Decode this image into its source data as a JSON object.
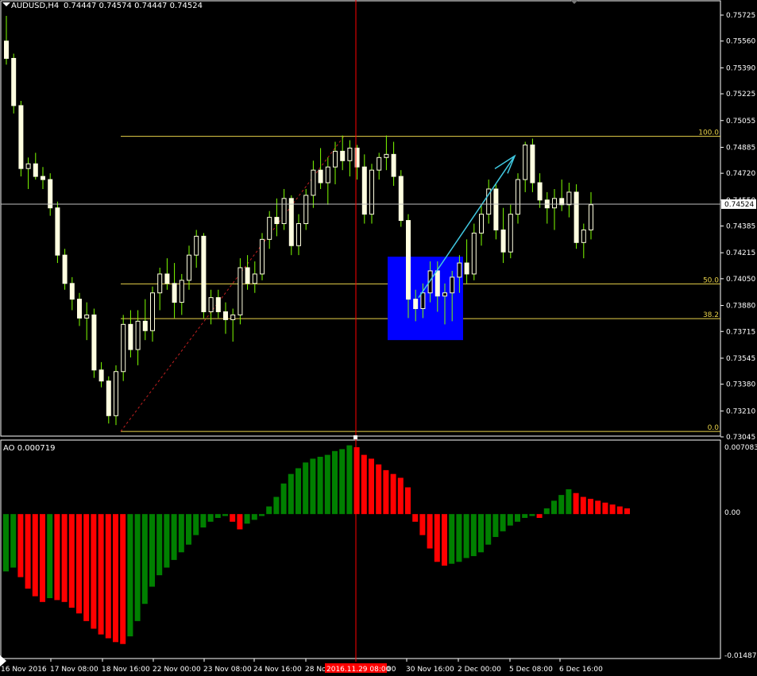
{
  "header": {
    "symbol": "AUDUSD,H4",
    "ohlc": "0.74447 0.74574 0.74447 0.74524"
  },
  "indicator": {
    "title": "AO 0.000719",
    "ticks": [
      "0.007083",
      "0.00",
      "-0.014871"
    ]
  },
  "price_axis": {
    "ticks": [
      "0.75725",
      "0.75560",
      "0.75390",
      "0.75225",
      "0.75055",
      "0.74885",
      "0.74720",
      "0.74550",
      "0.74385",
      "0.74215",
      "0.74050",
      "0.73880",
      "0.73715",
      "0.73545",
      "0.73380",
      "0.73210",
      "0.73045"
    ],
    "current": "0.74524"
  },
  "time_axis": {
    "labels": [
      "16 Nov 2016",
      "17 Nov 08:00",
      "18 Nov 16:00",
      "22 Nov 00:00",
      "23 Nov 08:00",
      "24 Nov 16:00",
      "28 No",
      "30 Nov 16:00",
      "2 Dec 00:00",
      "5 Dec 08:00",
      "6 Dec 16:00"
    ],
    "cursor_label": "2016.11.29 08:00",
    "cursor_suffix": "00"
  },
  "fibonacci": {
    "levels": [
      "100.0",
      "50.0",
      "38.2",
      "0.0"
    ]
  },
  "colors": {
    "bull": "#ffffe0",
    "wick": "#7fff00",
    "ao_up": "#008000",
    "ao_down": "#ff0000",
    "fib": "#e8d24a",
    "cursor": "#ff0000",
    "box": "#0000ff",
    "arrow": "#40c8e0"
  },
  "chart_data": [
    {
      "type": "candlestick",
      "title": "AUDUSD,H4",
      "ylim": [
        0.7302,
        0.7583
      ],
      "candles": [
        [
          0.7556,
          0.7572,
          0.7541,
          0.7545
        ],
        [
          0.7545,
          0.7548,
          0.751,
          0.7515
        ],
        [
          0.7515,
          0.7518,
          0.747,
          0.7475
        ],
        [
          0.7475,
          0.7482,
          0.7462,
          0.7478
        ],
        [
          0.7478,
          0.7485,
          0.7468,
          0.747
        ],
        [
          0.747,
          0.7476,
          0.7462,
          0.7468
        ],
        [
          0.7468,
          0.7472,
          0.7445,
          0.745
        ],
        [
          0.745,
          0.7454,
          0.7415,
          0.742
        ],
        [
          0.742,
          0.7424,
          0.7398,
          0.7402
        ],
        [
          0.7402,
          0.7406,
          0.7385,
          0.7392
        ],
        [
          0.7392,
          0.7396,
          0.7375,
          0.738
        ],
        [
          0.738,
          0.739,
          0.7366,
          0.7382
        ],
        [
          0.7382,
          0.7386,
          0.7342,
          0.7347
        ],
        [
          0.7347,
          0.7352,
          0.7336,
          0.734
        ],
        [
          0.734,
          0.7343,
          0.7313,
          0.7318
        ],
        [
          0.7318,
          0.735,
          0.7312,
          0.7346
        ],
        [
          0.7346,
          0.7382,
          0.734,
          0.7376
        ],
        [
          0.7376,
          0.7385,
          0.7355,
          0.736
        ],
        [
          0.736,
          0.7385,
          0.735,
          0.7378
        ],
        [
          0.7378,
          0.7392,
          0.7366,
          0.7372
        ],
        [
          0.7372,
          0.74,
          0.7365,
          0.7396
        ],
        [
          0.7396,
          0.7412,
          0.7385,
          0.7408
        ],
        [
          0.7408,
          0.7418,
          0.7398,
          0.7402
        ],
        [
          0.7402,
          0.7415,
          0.738,
          0.739
        ],
        [
          0.739,
          0.7408,
          0.7382,
          0.7404
        ],
        [
          0.7404,
          0.7426,
          0.7398,
          0.742
        ],
        [
          0.742,
          0.7436,
          0.7412,
          0.7432
        ],
        [
          0.7432,
          0.7434,
          0.738,
          0.7384
        ],
        [
          0.7384,
          0.7398,
          0.7376,
          0.7393
        ],
        [
          0.7393,
          0.7398,
          0.738,
          0.7384
        ],
        [
          0.7384,
          0.739,
          0.737,
          0.7379
        ],
        [
          0.7379,
          0.7386,
          0.7365,
          0.7382
        ],
        [
          0.7382,
          0.7418,
          0.7376,
          0.7412
        ],
        [
          0.7412,
          0.742,
          0.7398,
          0.7402
        ],
        [
          0.7402,
          0.7416,
          0.7396,
          0.7408
        ],
        [
          0.7408,
          0.7434,
          0.7404,
          0.743
        ],
        [
          0.743,
          0.7448,
          0.7424,
          0.7444
        ],
        [
          0.7444,
          0.7456,
          0.7432,
          0.744
        ],
        [
          0.744,
          0.7462,
          0.7436,
          0.7456
        ],
        [
          0.7456,
          0.7458,
          0.742,
          0.7426
        ],
        [
          0.7426,
          0.7446,
          0.742,
          0.744
        ],
        [
          0.744,
          0.7462,
          0.7436,
          0.7458
        ],
        [
          0.7458,
          0.748,
          0.745,
          0.7474
        ],
        [
          0.7474,
          0.7488,
          0.7462,
          0.7466
        ],
        [
          0.7466,
          0.7482,
          0.7452,
          0.7476
        ],
        [
          0.7476,
          0.7492,
          0.7465,
          0.7486
        ],
        [
          0.7486,
          0.7496,
          0.7474,
          0.748
        ],
        [
          0.748,
          0.7493,
          0.747,
          0.7488
        ],
        [
          0.7488,
          0.749,
          0.7468,
          0.7476
        ],
        [
          0.7476,
          0.7484,
          0.744,
          0.7446
        ],
        [
          0.7446,
          0.7478,
          0.744,
          0.7474
        ],
        [
          0.7474,
          0.7485,
          0.7468,
          0.7482
        ],
        [
          0.7482,
          0.7496,
          0.7474,
          0.7484
        ],
        [
          0.7484,
          0.7492,
          0.7464,
          0.747
        ],
        [
          0.747,
          0.7474,
          0.7438,
          0.7442
        ],
        [
          0.7442,
          0.7446,
          0.738,
          0.7392
        ],
        [
          0.7392,
          0.7398,
          0.7378,
          0.7386
        ],
        [
          0.7386,
          0.7402,
          0.738,
          0.7396
        ],
        [
          0.7396,
          0.7416,
          0.739,
          0.741
        ],
        [
          0.741,
          0.7416,
          0.7384,
          0.7394
        ],
        [
          0.7394,
          0.7402,
          0.7376,
          0.7396
        ],
        [
          0.7396,
          0.741,
          0.7378,
          0.7406
        ],
        [
          0.7406,
          0.742,
          0.7396,
          0.7415
        ],
        [
          0.7415,
          0.743,
          0.7402,
          0.7408
        ],
        [
          0.7408,
          0.744,
          0.7404,
          0.7434
        ],
        [
          0.7434,
          0.7452,
          0.7426,
          0.7446
        ],
        [
          0.7446,
          0.7468,
          0.744,
          0.7462
        ],
        [
          0.7462,
          0.7465,
          0.743,
          0.7436
        ],
        [
          0.7436,
          0.745,
          0.7415,
          0.7422
        ],
        [
          0.7422,
          0.7452,
          0.7418,
          0.7446
        ],
        [
          0.7446,
          0.7472,
          0.744,
          0.7468
        ],
        [
          0.7468,
          0.7492,
          0.746,
          0.749
        ],
        [
          0.749,
          0.7494,
          0.746,
          0.7466
        ],
        [
          0.7466,
          0.7472,
          0.745,
          0.7455
        ],
        [
          0.7455,
          0.746,
          0.744,
          0.745
        ],
        [
          0.745,
          0.7462,
          0.7436,
          0.7456
        ],
        [
          0.7456,
          0.7468,
          0.7448,
          0.7452
        ],
        [
          0.7452,
          0.7466,
          0.7444,
          0.746
        ],
        [
          0.746,
          0.7465,
          0.7424,
          0.7428
        ],
        [
          0.7428,
          0.744,
          0.7418,
          0.7436
        ],
        [
          0.7436,
          0.746,
          0.743,
          0.7452
        ]
      ]
    },
    {
      "type": "bar",
      "title": "AO 0.000719",
      "ylim": [
        -0.014871,
        0.007083
      ],
      "values": [
        -0.006,
        -0.0056,
        -0.0066,
        -0.0078,
        -0.0086,
        -0.0092,
        -0.0088,
        -0.009,
        -0.0092,
        -0.0098,
        -0.0104,
        -0.0112,
        -0.012,
        -0.0126,
        -0.013,
        -0.0134,
        -0.0136,
        -0.0128,
        -0.0112,
        -0.0094,
        -0.0076,
        -0.0064,
        -0.0056,
        -0.0048,
        -0.004,
        -0.0032,
        -0.0022,
        -0.0014,
        -0.0008,
        -0.0004,
        -0.0002,
        -0.0008,
        -0.0016,
        -0.001,
        -0.0006,
        -0.0002,
        0.0008,
        0.0018,
        0.0032,
        0.0042,
        0.0048,
        0.0054,
        0.0058,
        0.006,
        0.0062,
        0.0066,
        0.0068,
        0.0072,
        0.007,
        0.0062,
        0.0058,
        0.0052,
        0.0046,
        0.0042,
        0.0038,
        0.0028,
        -0.0008,
        -0.0022,
        -0.0036,
        -0.005,
        -0.0054,
        -0.0052,
        -0.005,
        -0.0046,
        -0.0044,
        -0.004,
        -0.0032,
        -0.0024,
        -0.0018,
        -0.0012,
        -0.0008,
        -0.0004,
        -0.0002,
        -0.0004,
        0.0006,
        0.0014,
        0.002,
        0.0026,
        0.0022,
        0.0018,
        0.0016,
        0.0014,
        0.0012,
        0.001,
        0.0008,
        0.0006
      ]
    }
  ]
}
